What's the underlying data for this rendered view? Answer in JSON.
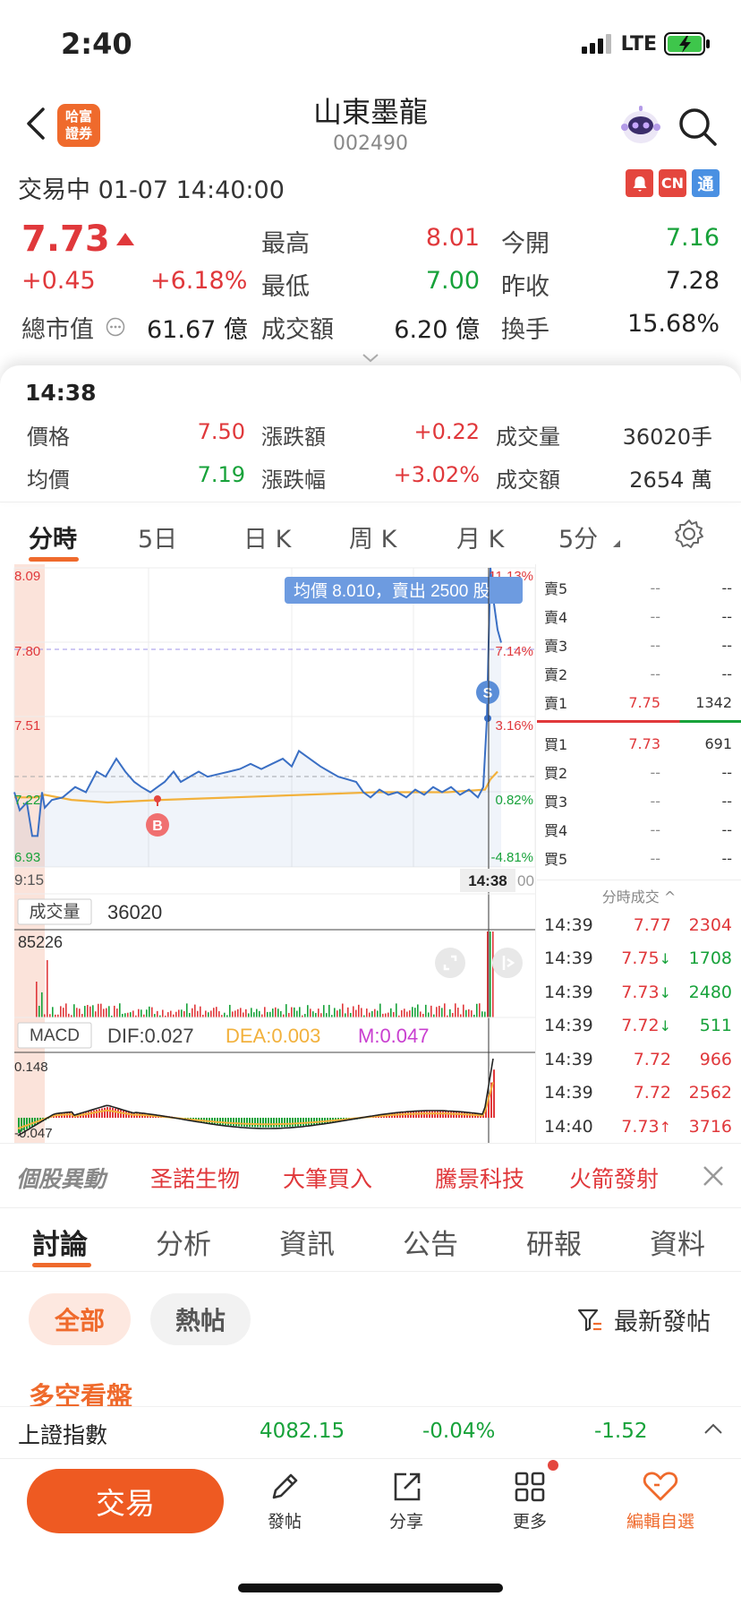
{
  "status_bar": {
    "time": "2:40",
    "network": "LTE"
  },
  "header": {
    "brand_line1": "哈富",
    "brand_line2": "證券",
    "title": "山東墨龍",
    "code": "002490",
    "trade_status": "交易中  01-07 14:40:00",
    "badge_cn": "CN",
    "badge_tong": "通"
  },
  "quote": {
    "price": "7.73",
    "change": "+0.45",
    "change_pct": "+6.18%",
    "high_label": "最高",
    "high": "8.01",
    "open_label": "今開",
    "open": "7.16",
    "low_label": "最低",
    "low": "7.00",
    "prev_close_label": "昨收",
    "prev_close": "7.28",
    "mktcap_label": "總市值",
    "mktcap": "61.67 億",
    "amount_label": "成交額",
    "amount": "6.20 億",
    "turnover_label": "換手",
    "turnover": "15.68%"
  },
  "detail": {
    "time": "14:38",
    "price_label": "價格",
    "price": "7.50",
    "chg_label": "漲跌額",
    "chg": "+0.22",
    "vol_label": "成交量",
    "vol": "36020手",
    "avg_label": "均價",
    "avg": "7.19",
    "chgpct_label": "漲跌幅",
    "chgpct": "+3.02%",
    "amt_label": "成交額",
    "amt": "2654 萬"
  },
  "chart_tabs": [
    "分時",
    "5日",
    "日 K",
    "周 K",
    "月 K",
    "5分"
  ],
  "chart": {
    "price_axis": [
      "8.09",
      "7.80",
      "7.51",
      "7.22",
      "6.93"
    ],
    "pct_axis": [
      "11.13%",
      "7.14%",
      "3.16%",
      "0.82%",
      "-4.81%"
    ],
    "tooltip": "均價 8.010，賣出 2500 股",
    "start_time": "9:15",
    "cursor_time": "14:38",
    "cursor_time_tail": "00",
    "marker_buy": "B",
    "marker_sell": "S",
    "volume_label": "成交量",
    "volume_value": "36020",
    "volume_max": "85226",
    "macd_label": "MACD",
    "dif": "DIF:0.027",
    "dea": "DEA:0.003",
    "m": "M:0.047",
    "macd_top": "0.148",
    "macd_bottom": "-0.047",
    "colors": {
      "price_line": "#3a6fc4",
      "avg_line": "#f2b13c",
      "up": "#e0383b",
      "down": "#17a23a"
    }
  },
  "order_book": {
    "asks": [
      {
        "name": "賣5",
        "price": "--",
        "vol": "--"
      },
      {
        "name": "賣4",
        "price": "--",
        "vol": "--"
      },
      {
        "name": "賣3",
        "price": "--",
        "vol": "--"
      },
      {
        "name": "賣2",
        "price": "--",
        "vol": "--"
      },
      {
        "name": "賣1",
        "price": "7.75",
        "vol": "1342"
      }
    ],
    "bids": [
      {
        "name": "買1",
        "price": "7.73",
        "vol": "691"
      },
      {
        "name": "買2",
        "price": "--",
        "vol": "--"
      },
      {
        "name": "買3",
        "price": "--",
        "vol": "--"
      },
      {
        "name": "買4",
        "price": "--",
        "vol": "--"
      },
      {
        "name": "買5",
        "price": "--",
        "vol": "--"
      }
    ]
  },
  "ticks": {
    "header": "分時成交 ^",
    "rows": [
      {
        "time": "14:39",
        "price": "7.77",
        "vol": "2304",
        "dir": ""
      },
      {
        "time": "14:39",
        "price": "7.75",
        "vol": "1708",
        "dir": "↓"
      },
      {
        "time": "14:39",
        "price": "7.73",
        "vol": "2480",
        "dir": "↓"
      },
      {
        "time": "14:39",
        "price": "7.72",
        "vol": "511",
        "dir": "↓"
      },
      {
        "time": "14:39",
        "price": "7.72",
        "vol": "966",
        "dir": ""
      },
      {
        "time": "14:39",
        "price": "7.72",
        "vol": "2562",
        "dir": ""
      },
      {
        "time": "14:40",
        "price": "7.73",
        "vol": "3716",
        "dir": "↑"
      }
    ]
  },
  "movers": {
    "title": "個股異動",
    "items": [
      "圣諾生物",
      "大筆買入",
      "騰景科技",
      "火箭發射"
    ]
  },
  "discussion_tabs": [
    "討論",
    "分析",
    "資訊",
    "公告",
    "研報",
    "資料"
  ],
  "filters": {
    "all": "全部",
    "hot": "熱帖",
    "sort": "最新發帖"
  },
  "section_title": "多空看盤",
  "index_bar": {
    "name": "上證指數",
    "value": "4082.15",
    "pct": "-0.04%",
    "chg": "-1.52"
  },
  "bottom_nav": {
    "trade": "交易",
    "post": "發帖",
    "share": "分享",
    "more": "更多",
    "watchlist": "編輯自選"
  }
}
